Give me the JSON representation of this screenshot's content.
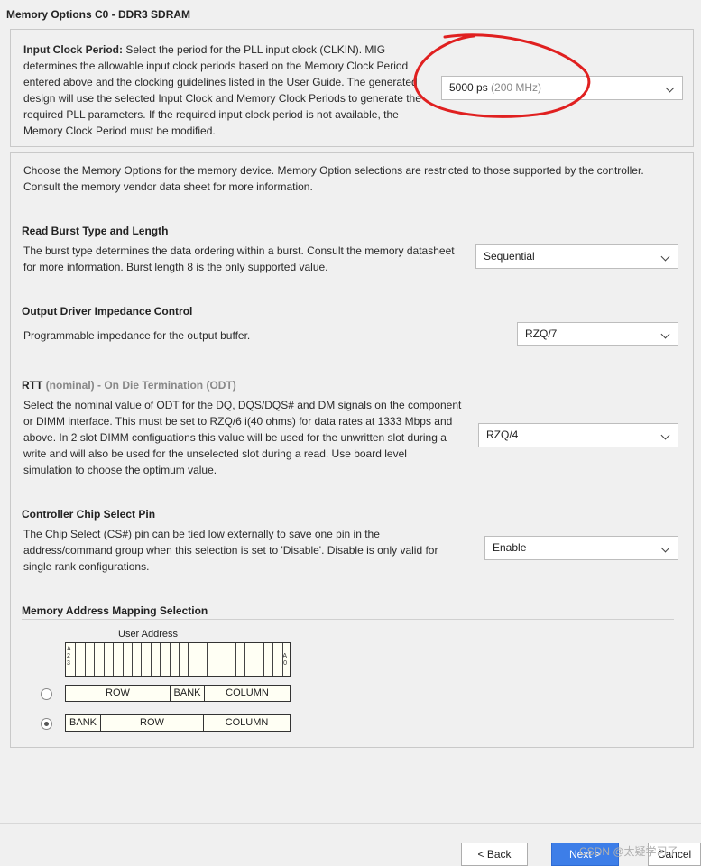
{
  "header": {
    "title": "Memory Options C0 - DDR3 SDRAM"
  },
  "input_clock": {
    "label": "Input Clock Period:",
    "description": "Select the period for the PLL input clock (CLKIN). MIG determines the allowable input clock periods based on the Memory Clock Period entered above and the clocking guidelines listed in the User Guide. The generated design will use the selected Input Clock and Memory Clock Periods to generate the required PLL parameters. If the required input clock period is not available, the Memory Clock Period must be modified.",
    "lines": [
      "determines the allowable input clock periods based on the Memory Clock Period",
      "entered above and the clocking guidelines listed in the User Guide. The generated",
      "design will use the selected Input Clock and Memory Clock Periods to generate the",
      "required PLL parameters. If the required input clock period is not available, the",
      "Memory Clock Period must be modified."
    ],
    "first_line_rest": " Select the period for the PLL input clock (CLKIN). MIG",
    "value": "5000 ps",
    "value_hint": "(200 MHz)"
  },
  "memory_options": {
    "intro_lines": [
      "Choose the Memory Options for the memory device. Memory Option selections are restricted to those supported by the controller.",
      "Consult the memory vendor data sheet for more information."
    ]
  },
  "read_burst": {
    "title": "Read Burst Type and Length",
    "lines": [
      "The burst type determines the data ordering within a burst. Consult the memory datasheet",
      "for more information. Burst length 8 is the only supported value."
    ],
    "value": "Sequential"
  },
  "output_driver": {
    "title": "Output Driver Impedance Control",
    "description": "Programmable impedance for the output buffer.",
    "value": "RZQ/7"
  },
  "rtt": {
    "title_main": "RTT",
    "title_rest": " (nominal) - On Die Termination (ODT)",
    "lines": [
      "Select the nominal value of ODT for the DQ, DQS/DQS# and DM signals on the component",
      "or DIMM interface. This must be set to RZQ/6 i(40 ohms) for data rates at 1333 Mbps and",
      "above. In 2 slot DIMM configuations this value will be used for the unwritten slot during a",
      "write and will also be used for the unselected slot during a read. Use board level",
      "simulation to choose the optimum value."
    ],
    "value": "RZQ/4"
  },
  "chip_select": {
    "title": "Controller Chip Select Pin",
    "lines": [
      "The Chip Select (CS#) pin can be tied low externally to save one pin in the",
      "address/command group when this selection is set to 'Disable'. Disable is only valid for",
      "single rank configurations."
    ],
    "value": "Enable"
  },
  "address_mapping": {
    "title": "Memory Address Mapping Selection",
    "user_address_label": "User Address",
    "high_bit_label": [
      "A",
      "2",
      "3"
    ],
    "low_bit_label": [
      "A",
      "0"
    ],
    "bit_count": 24,
    "option1": {
      "selected": false,
      "fields": [
        "ROW",
        "BANK",
        "COLUMN"
      ]
    },
    "option2": {
      "selected": true,
      "fields": [
        "BANK",
        "ROW",
        "COLUMN"
      ]
    }
  },
  "footer": {
    "back_label": "< Back",
    "next_label": "Next >",
    "cancel_label": "Cancel",
    "watermark": "CSDN @太疑学习了"
  },
  "colors": {
    "annotation": "#e02020",
    "next_button": "#3d7ee8"
  }
}
